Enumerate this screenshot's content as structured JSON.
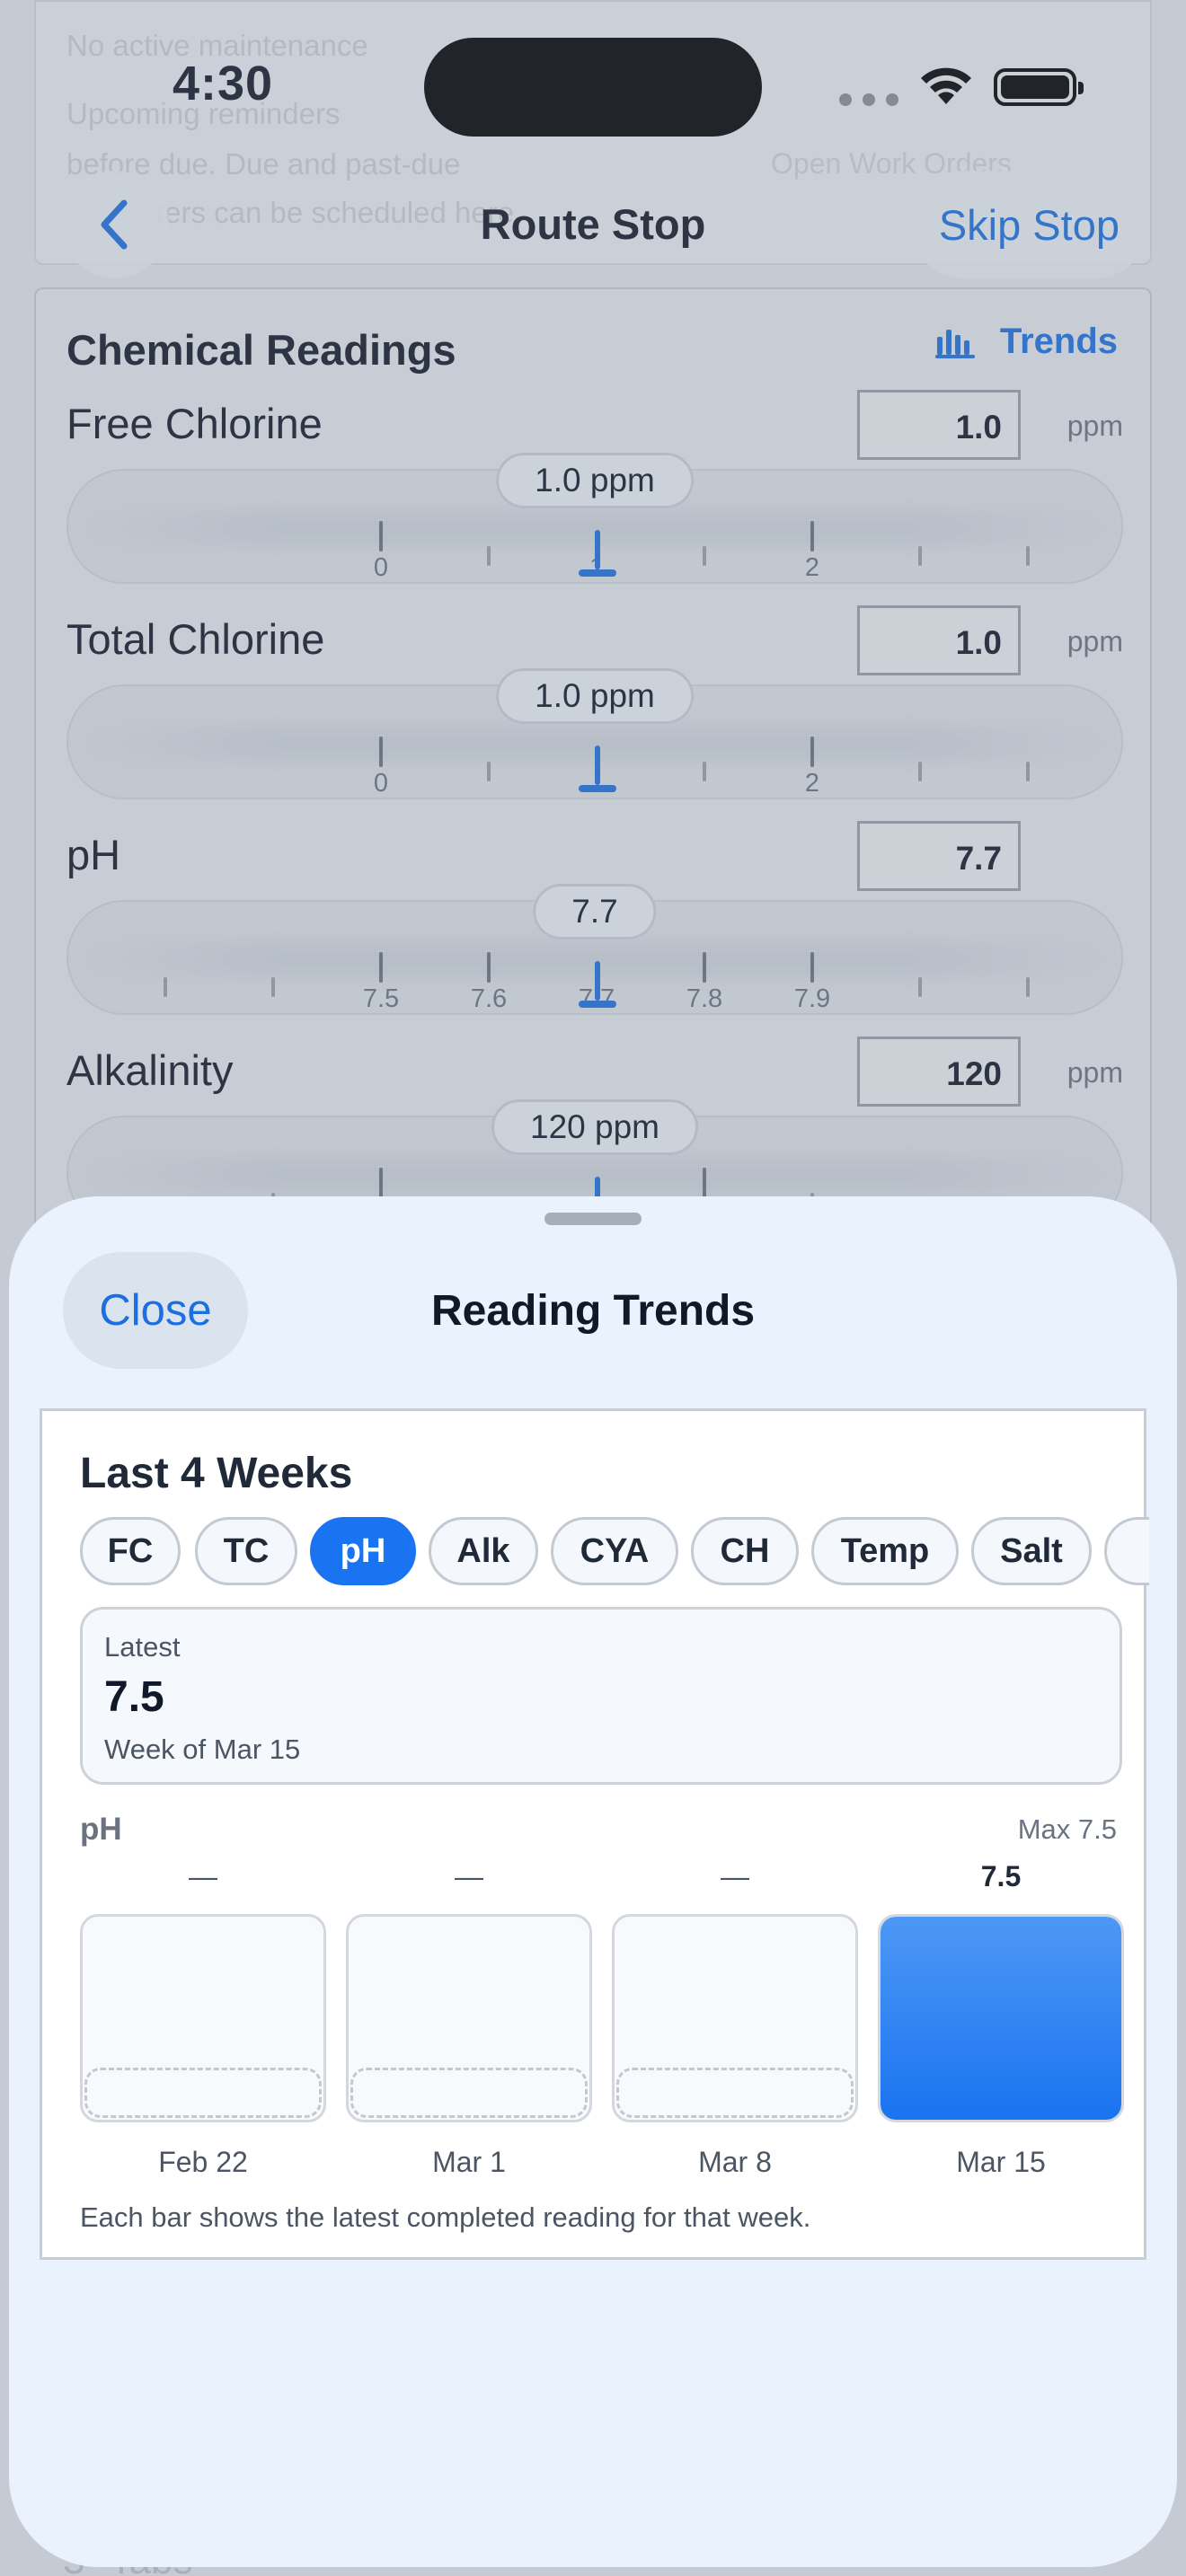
{
  "status_bar": {
    "time": "4:30"
  },
  "background": {
    "ghost_lines": [
      "No active maintenance",
      "Upcoming reminders",
      "before due. Due and past-due",
      "ters can be scheduled here."
    ],
    "ghost_link": "Open Work Orders",
    "bottom_ghost": "3\" Tabs"
  },
  "nav": {
    "title": "Route Stop",
    "skip_label": "Skip Stop",
    "back_icon": "chevron-left-icon"
  },
  "chemical_readings": {
    "title": "Chemical Readings",
    "trends_label": "Trends",
    "rows": [
      {
        "label": "Free Chlorine",
        "value": "1.0",
        "unit": "ppm",
        "pill": "1.0 ppm",
        "scale_labels": [
          "0",
          "1",
          "2"
        ]
      },
      {
        "label": "Total Chlorine",
        "value": "1.0",
        "unit": "ppm",
        "pill": "1.0 ppm",
        "scale_labels": [
          "0",
          "1",
          "2"
        ]
      },
      {
        "label": "pH",
        "value": "7.7",
        "unit": "",
        "pill": "7.7",
        "scale_labels": [
          "7.5",
          "7.6",
          "7.7",
          "7.8",
          "7.9"
        ]
      },
      {
        "label": "Alkalinity",
        "value": "120",
        "unit": "ppm",
        "pill": "120 ppm",
        "scale_labels": []
      }
    ]
  },
  "sheet": {
    "close_label": "Close",
    "title": "Reading Trends",
    "card": {
      "heading": "Last 4 Weeks",
      "chips": [
        "FC",
        "TC",
        "pH",
        "Alk",
        "CYA",
        "CH",
        "Temp",
        "Salt"
      ],
      "active_chip": "pH",
      "latest": {
        "caption": "Latest",
        "value": "7.5",
        "sub": "Week of Mar 15"
      },
      "chart_label": "pH",
      "chart_max": "Max 7.5",
      "note": "Each bar shows the latest completed reading for that week."
    }
  },
  "chart_data": {
    "type": "bar",
    "categories": [
      "Feb 22",
      "Mar 1",
      "Mar 8",
      "Mar 15"
    ],
    "values": [
      null,
      null,
      null,
      7.5
    ],
    "value_labels": [
      "—",
      "—",
      "—",
      "7.5"
    ],
    "max": 7.5,
    "fill_color": "#1a73f0"
  },
  "colors": {
    "accent": "#1b6fe0",
    "chip_active": "#1a73f0"
  }
}
